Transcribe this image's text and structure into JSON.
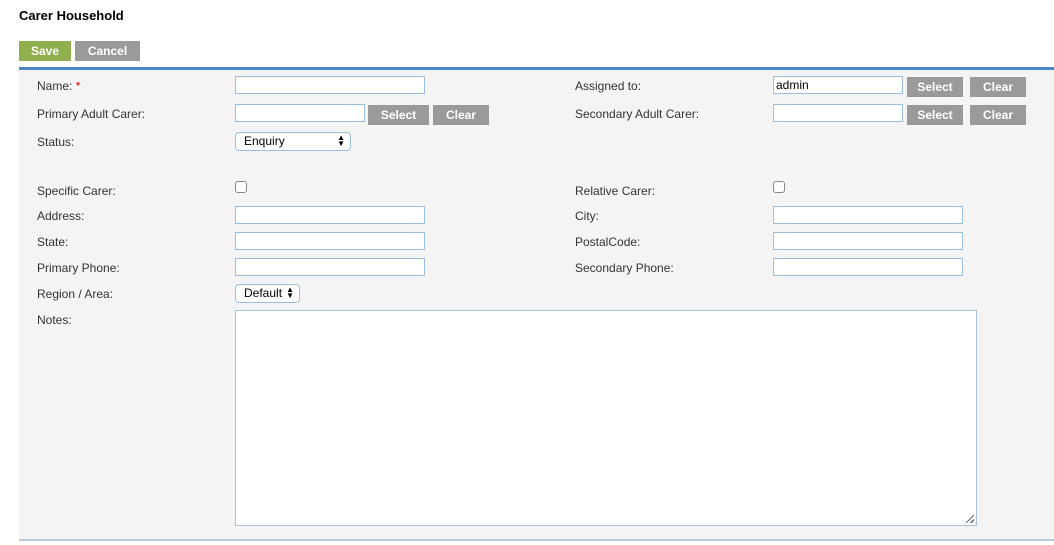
{
  "page": {
    "title": "Carer Household"
  },
  "toolbar": {
    "save_label": "Save",
    "cancel_label": "Cancel"
  },
  "form": {
    "name": {
      "label": "Name:",
      "required_marker": "*",
      "value": ""
    },
    "assigned_to": {
      "label": "Assigned to:",
      "value": "admin",
      "select_label": "Select",
      "clear_label": "Clear"
    },
    "primary_adult_carer": {
      "label": "Primary Adult Carer:",
      "value": "",
      "select_label": "Select",
      "clear_label": "Clear"
    },
    "secondary_adult_carer": {
      "label": "Secondary Adult Carer:",
      "value": "",
      "select_label": "Select",
      "clear_label": "Clear"
    },
    "status": {
      "label": "Status:",
      "selected": "Enquiry"
    },
    "specific_carer": {
      "label": "Specific Carer:",
      "checked": false
    },
    "relative_carer": {
      "label": "Relative Carer:",
      "checked": false
    },
    "address": {
      "label": "Address:",
      "value": ""
    },
    "city": {
      "label": "City:",
      "value": ""
    },
    "state": {
      "label": "State:",
      "value": ""
    },
    "postal_code": {
      "label": "PostalCode:",
      "value": ""
    },
    "primary_phone": {
      "label": "Primary Phone:",
      "value": ""
    },
    "secondary_phone": {
      "label": "Secondary Phone:",
      "value": ""
    },
    "region": {
      "label": "Region / Area:",
      "selected": "Default"
    },
    "notes": {
      "label": "Notes:",
      "value": ""
    }
  }
}
